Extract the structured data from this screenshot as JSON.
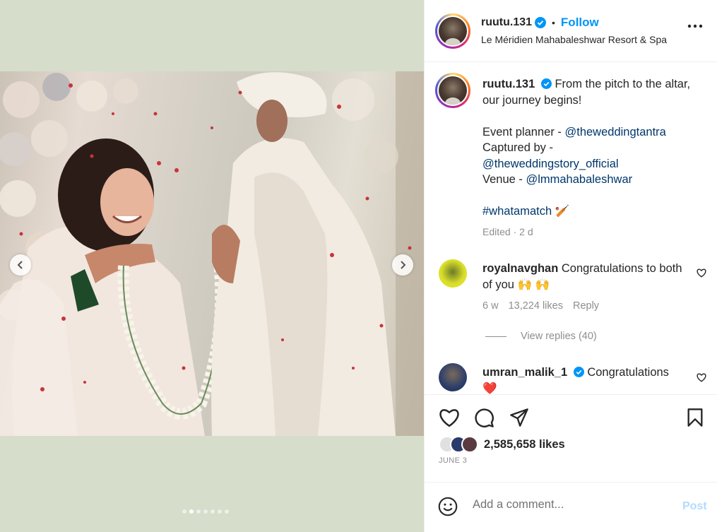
{
  "post": {
    "username": "ruutu.131",
    "follow_label": "Follow",
    "separator": "•",
    "location": "Le Méridien Mahabaleshwar Resort & Spa"
  },
  "caption": {
    "username": "ruutu.131",
    "line1": "From the pitch to the altar, our journey begins!",
    "planner_label": "Event planner - ",
    "planner_handle": "@theweddingtantra",
    "captured_label": "Captured by -",
    "captured_handle": "@theweddingstory_official",
    "venue_label": "Venue - ",
    "venue_handle": "@lmmahabaleshwar",
    "hashtag": "#whatamatch",
    "hashtag_emoji": "🏏",
    "edited": "Edited · 2 d"
  },
  "comments": [
    {
      "username": "royalnavghan",
      "text": "Congratulations to both of you 🙌 🙌",
      "time": "6 w",
      "likes": "13,224 likes",
      "reply": "Reply",
      "view_replies": "View replies (40)"
    },
    {
      "username": "umran_malik_1",
      "text": "Congratulations",
      "emoji": "❤️"
    }
  ],
  "actions": {
    "likes": "2,585,658 likes",
    "date": "JUNE 3"
  },
  "composer": {
    "placeholder": "Add a comment...",
    "post_label": "Post"
  },
  "carousel": {
    "dot_count": 7,
    "active_index": 1
  },
  "icons": [
    "verified-badge-icon",
    "more-options-icon",
    "chevron-left-icon",
    "chevron-right-icon",
    "heart-icon",
    "comment-icon",
    "share-icon",
    "bookmark-icon",
    "emoji-icon"
  ],
  "colors": {
    "accent": "#0095f6",
    "link": "#00376b",
    "muted": "#8e8e8e",
    "media_bg": "#d6ddcb"
  }
}
